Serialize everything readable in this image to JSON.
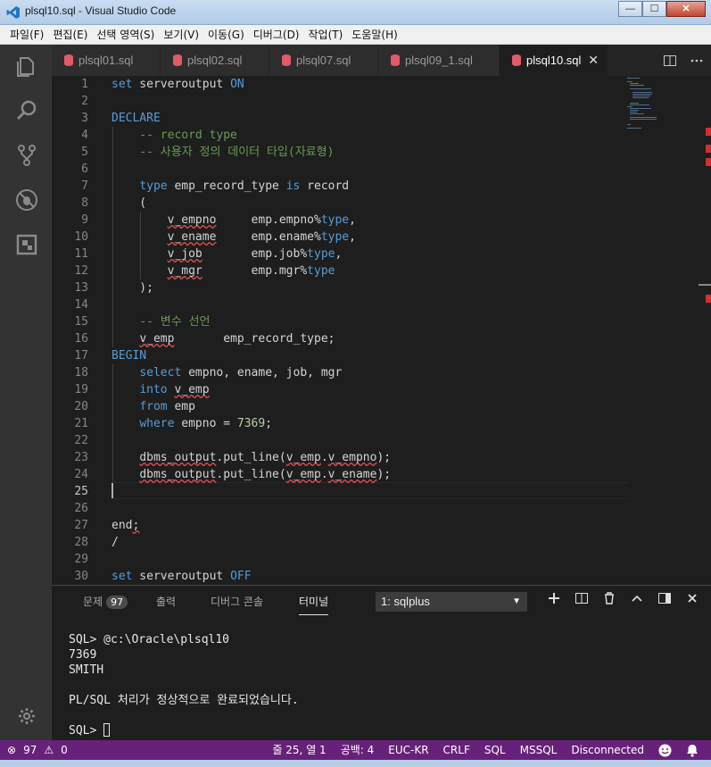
{
  "window": {
    "title": "plsql10.sql - Visual Studio Code",
    "min": "—",
    "max": "☐",
    "close": "✕"
  },
  "menu": [
    "파일(F)",
    "편집(E)",
    "선택 영역(S)",
    "보기(V)",
    "이동(G)",
    "디버그(D)",
    "작업(T)",
    "도움말(H)"
  ],
  "tabs": [
    {
      "label": "plsql01.sql",
      "active": false
    },
    {
      "label": "plsql02.sql",
      "active": false
    },
    {
      "label": "plsql07.sql",
      "active": false
    },
    {
      "label": "plsql09_1.sql",
      "active": false
    },
    {
      "label": "plsql10.sql",
      "active": true
    }
  ],
  "tab_close": "✕",
  "editor": {
    "current_line": 25,
    "lines": [
      "set serveroutput ON",
      "",
      "DECLARE",
      "    -- record type",
      "    -- 사용자 정의 데이터 타입(자료형)",
      "",
      "    type emp_record_type is record",
      "    (",
      "        v_empno     emp.empno%type,",
      "        v_ename     emp.ename%type,",
      "        v_job       emp.job%type,",
      "        v_mgr       emp.mgr%type",
      "    );",
      "",
      "    -- 변수 선언",
      "    v_emp       emp_record_type;",
      "BEGIN",
      "    select empno, ename, job, mgr",
      "    into v_emp",
      "    from emp",
      "    where empno = 7369;",
      "",
      "    dbms_output.put_line(v_emp.v_empno);",
      "    dbms_output.put_line(v_emp.v_ename);",
      "",
      "",
      "end;",
      "/",
      "",
      "set serveroutput OFF"
    ]
  },
  "panel": {
    "tabs": [
      {
        "label": "문제",
        "badge": "97"
      },
      {
        "label": "출력"
      },
      {
        "label": "디버그 콘솔"
      },
      {
        "label": "터미널",
        "active": true
      }
    ],
    "terminal_select": "1: sqlplus",
    "terminal_lines": [
      "SQL> @c:\\Oracle\\plsql10",
      "7369",
      "SMITH",
      "",
      "PL/SQL 처리가 정상적으로 완료되었습니다.",
      ""
    ],
    "prompt": "SQL> "
  },
  "status": {
    "errors": "97",
    "warnings": "0",
    "position": "줄 25, 열 1",
    "spaces": "공백: 4",
    "encoding": "EUC-KR",
    "eol": "CRLF",
    "language": "SQL",
    "dialect": "MSSQL",
    "connection": "Disconnected"
  },
  "colors": {
    "statusbar": "#68217a",
    "keyword": "#569cd6",
    "comment": "#6a9955",
    "number": "#b5cea8"
  }
}
